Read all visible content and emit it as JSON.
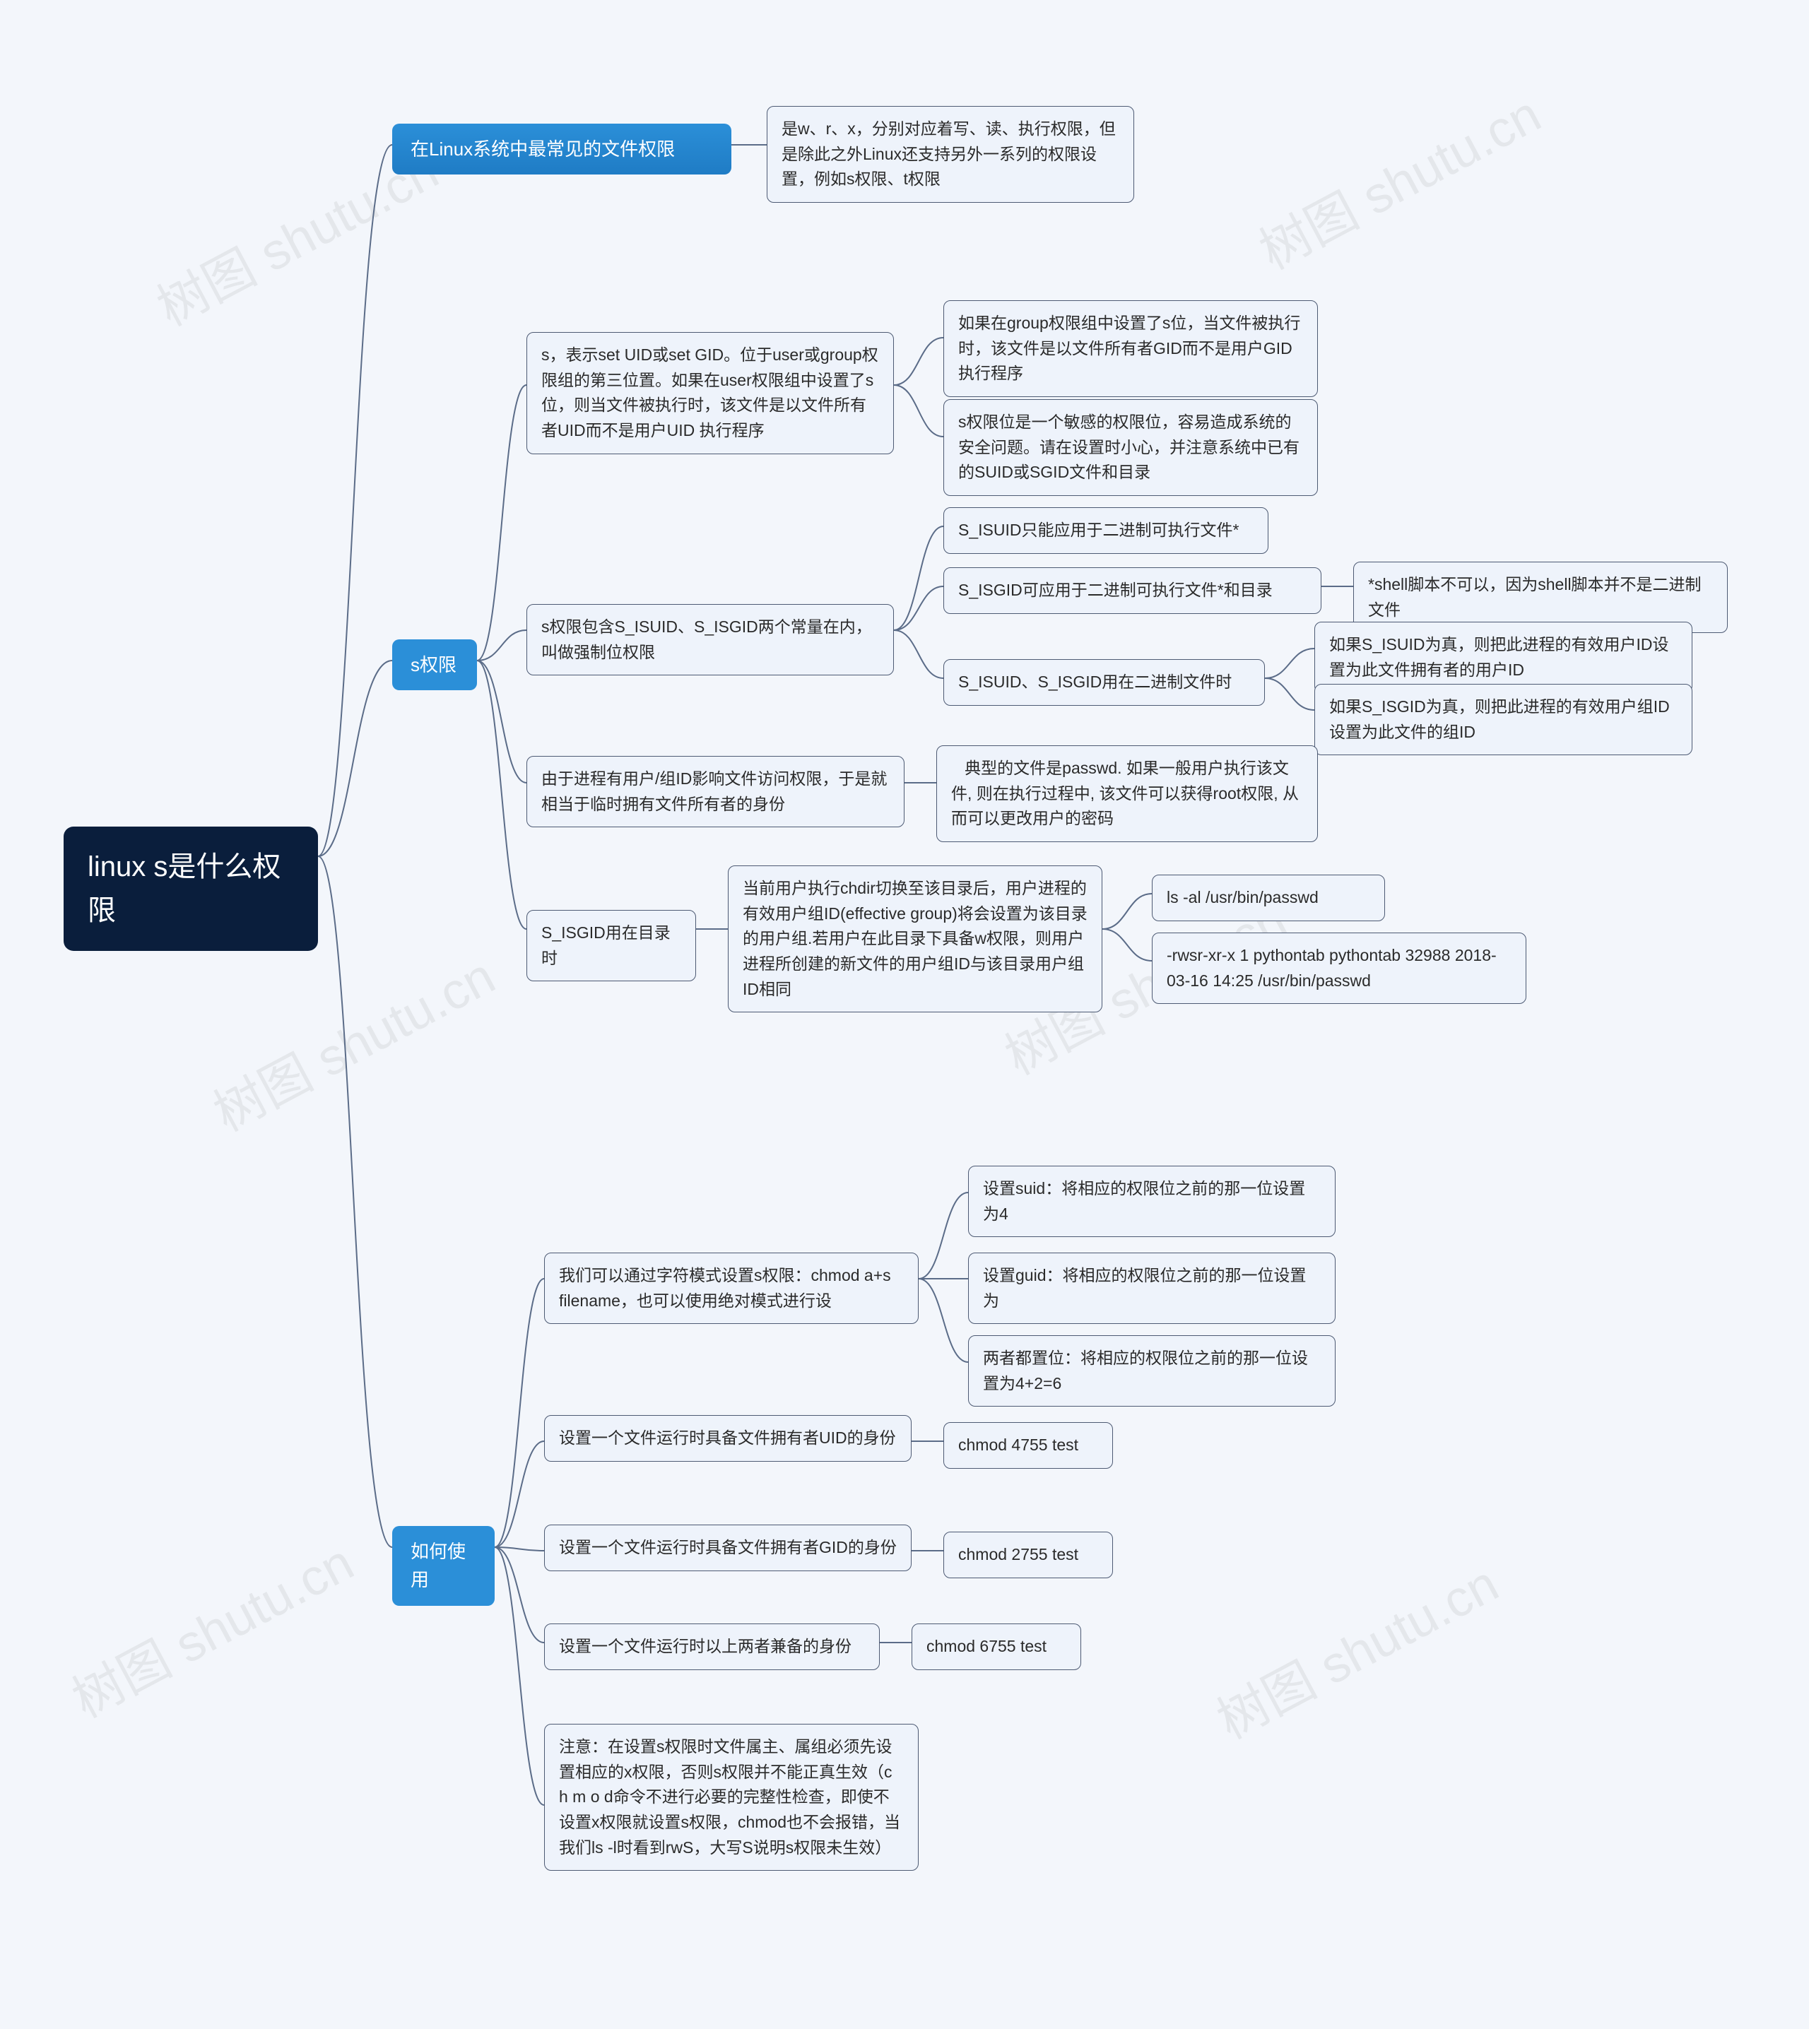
{
  "watermark": "树图 shutu.cn",
  "root": "linux s是什么权限",
  "b_common": "在Linux系统中最常见的文件权限",
  "b_s": "s权限",
  "b_use": "如何使用",
  "common_desc": "是w、r、x，分别对应着写、读、执行权限，但是除此之外Linux还支持另外一系列的权限设置，例如s权限、t权限",
  "s_setuid": "s，表示set UID或set GID。位于user或group权限组的第三位置。如果在user权限组中设置了s位，则当文件被执行时，该文件是以文件所有者UID而不是用户UID 执行程序",
  "s_setuid_c1": "如果在group权限组中设置了s位，当文件被执行时，该文件是以文件所有者GID而不是用户GID执行程序",
  "s_setuid_c2": "s权限位是一个敏感的权限位，容易造成系统的安全问题。请在设置时小心，并注意系统中已有的SUID或SGID文件和目录",
  "s_force": "s权限包含S_ISUID、S_ISGID两个常量在内，叫做强制位权限",
  "s_force_c1": "S_ISUID只能应用于二进制可执行文件*",
  "s_force_c2": "S_ISGID可应用于二进制可执行文件*和目录",
  "s_force_c2_c": "*shell脚本不可以，因为shell脚本并不是二进制文件",
  "s_force_c3": "S_ISUID、S_ISGID用在二进制文件时",
  "s_force_c3_c1": "如果S_ISUID为真，则把此进程的有效用户ID设置为此文件拥有者的用户ID",
  "s_force_c3_c2": "如果S_ISGID为真，则把此进程的有效用户组ID设置为此文件的组ID",
  "s_temp": "由于进程有用户/组ID影响文件访问权限，于是就相当于临时拥有文件所有者的身份",
  "s_temp_c": "   典型的文件是passwd. 如果一般用户执行该文件, 则在执行过程中, 该文件可以获得root权限, 从而可以更改用户的密码",
  "s_isgid_dir": "S_ISGID用在目录时",
  "s_isgid_dir_c": "当前用户执行chdir切换至该目录后，用户进程的有效用户组ID(effective group)将会设置为该目录的用户组.若用户在此目录下具备w权限，则用户进程所创建的新文件的用户组ID与该目录用户组ID相同",
  "s_isgid_cmd1": "ls -al /usr/bin/passwd",
  "s_isgid_cmd2": "-rwsr-xr-x 1 pythontab pythontab 32988 2018-03-16 14:25 /usr/bin/passwd",
  "u_chmod": "我们可以通过字符模式设置s权限：chmod a+s filename，也可以使用绝对模式进行设",
  "u_chmod_c1": "设置suid：将相应的权限位之前的那一位设置为4",
  "u_chmod_c2": "设置guid：将相应的权限位之前的那一位设置为",
  "u_chmod_c3": "两者都置位：将相应的权限位之前的那一位设置为4+2=6",
  "u_uid": "设置一个文件运行时具备文件拥有者UID的身份",
  "u_uid_c": "chmod 4755 test",
  "u_gid": "设置一个文件运行时具备文件拥有者GID的身份",
  "u_gid_c": "chmod 2755 test",
  "u_both": "设置一个文件运行时以上两者兼备的身份",
  "u_both_c": "chmod 6755 test",
  "u_note": "注意：在设置s权限时文件属主、属组必须先设置相应的x权限，否则s权限并不能正真生效（c h m o d命令不进行必要的完整性检查，即使不设置x权限就设置s权限，chmod也不会报错，当我们ls -l时看到rwS，大写S说明s权限未生效）"
}
